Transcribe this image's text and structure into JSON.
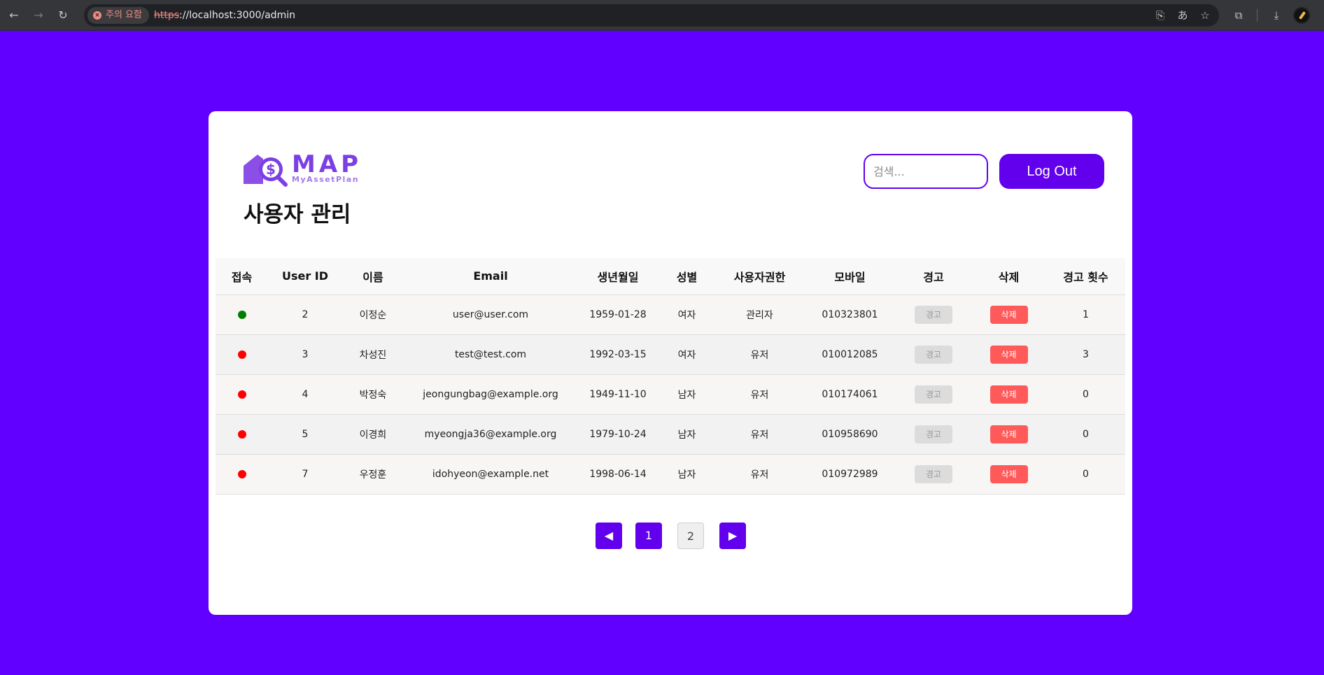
{
  "browser": {
    "warning_chip": "주의 요함",
    "url_scheme": "https",
    "url_rest": "://localhost:3000/admin"
  },
  "header": {
    "logo_text": "MAP",
    "logo_subtext": "MyAssetPlan",
    "page_title": "사용자 관리",
    "search_placeholder": "검색...",
    "logout_label": "Log Out"
  },
  "table": {
    "columns": [
      "접속",
      "User ID",
      "이름",
      "Email",
      "생년월일",
      "성별",
      "사용자권한",
      "모바일",
      "경고",
      "삭제",
      "경고 횟수"
    ],
    "warn_label": "경고",
    "delete_label": "삭제",
    "rows": [
      {
        "online": true,
        "id": "2",
        "name": "이정순",
        "email": "user@user.com",
        "birth": "1959-01-28",
        "gender": "여자",
        "role": "관리자",
        "mobile": "010323801",
        "warn_count": "1"
      },
      {
        "online": false,
        "id": "3",
        "name": "차성진",
        "email": "test@test.com",
        "birth": "1992-03-15",
        "gender": "여자",
        "role": "유저",
        "mobile": "010012085",
        "warn_count": "3"
      },
      {
        "online": false,
        "id": "4",
        "name": "박정숙",
        "email": "jeongungbag@example.org",
        "birth": "1949-11-10",
        "gender": "남자",
        "role": "유저",
        "mobile": "010174061",
        "warn_count": "0"
      },
      {
        "online": false,
        "id": "5",
        "name": "이경희",
        "email": "myeongja36@example.org",
        "birth": "1979-10-24",
        "gender": "남자",
        "role": "유저",
        "mobile": "010958690",
        "warn_count": "0"
      },
      {
        "online": false,
        "id": "7",
        "name": "우정훈",
        "email": "idohyeon@example.net",
        "birth": "1998-06-14",
        "gender": "남자",
        "role": "유저",
        "mobile": "010972989",
        "warn_count": "0"
      }
    ]
  },
  "pagination": {
    "prev": "◀",
    "pages": [
      "1",
      "2"
    ],
    "next": "▶",
    "current": "1"
  },
  "colors": {
    "background": "#6200ff",
    "accent": "#6200ee",
    "online": "#008000",
    "offline": "#ff0000",
    "delete": "#ff5a5a"
  }
}
